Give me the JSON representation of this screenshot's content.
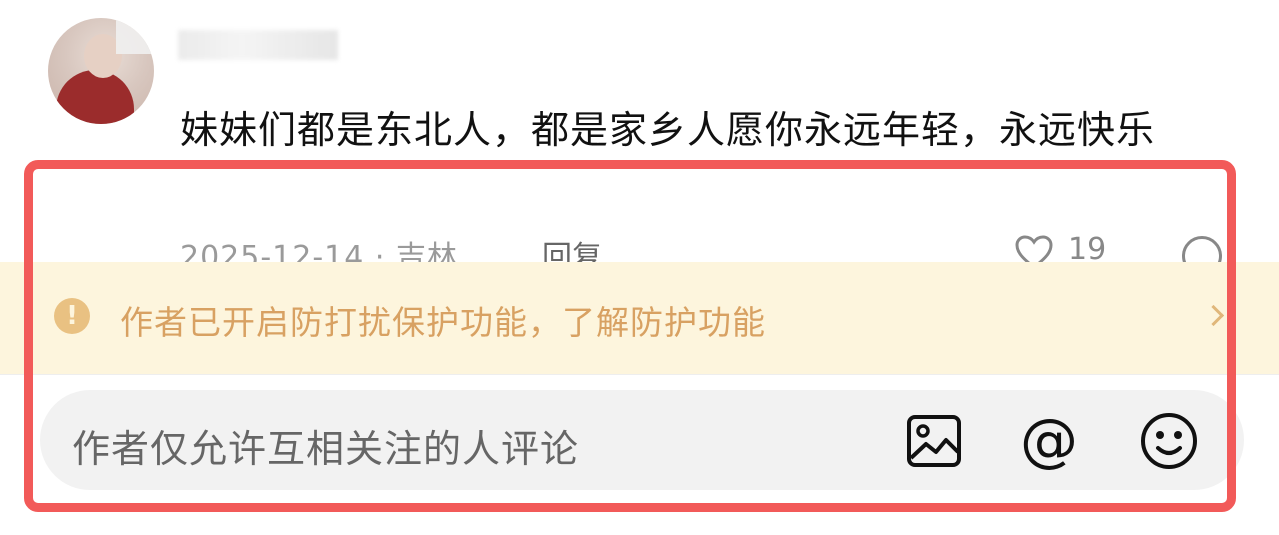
{
  "comment": {
    "text": "妹妹们都是东北人，都是家乡人愿你永远年轻，永远快乐",
    "date_location": "2025-12-14 · 吉林",
    "reply_label": "回复",
    "like_count": "19"
  },
  "notice": {
    "text": "作者已开启防打扰保护功能，了解防护功能",
    "icon": "warning-icon",
    "color": "#d8a162"
  },
  "input": {
    "placeholder": "作者仅允许互相关注的人评论",
    "icons": [
      "image-icon",
      "at-icon",
      "emoji-icon"
    ]
  },
  "highlight": {
    "color": "#f25a59"
  }
}
